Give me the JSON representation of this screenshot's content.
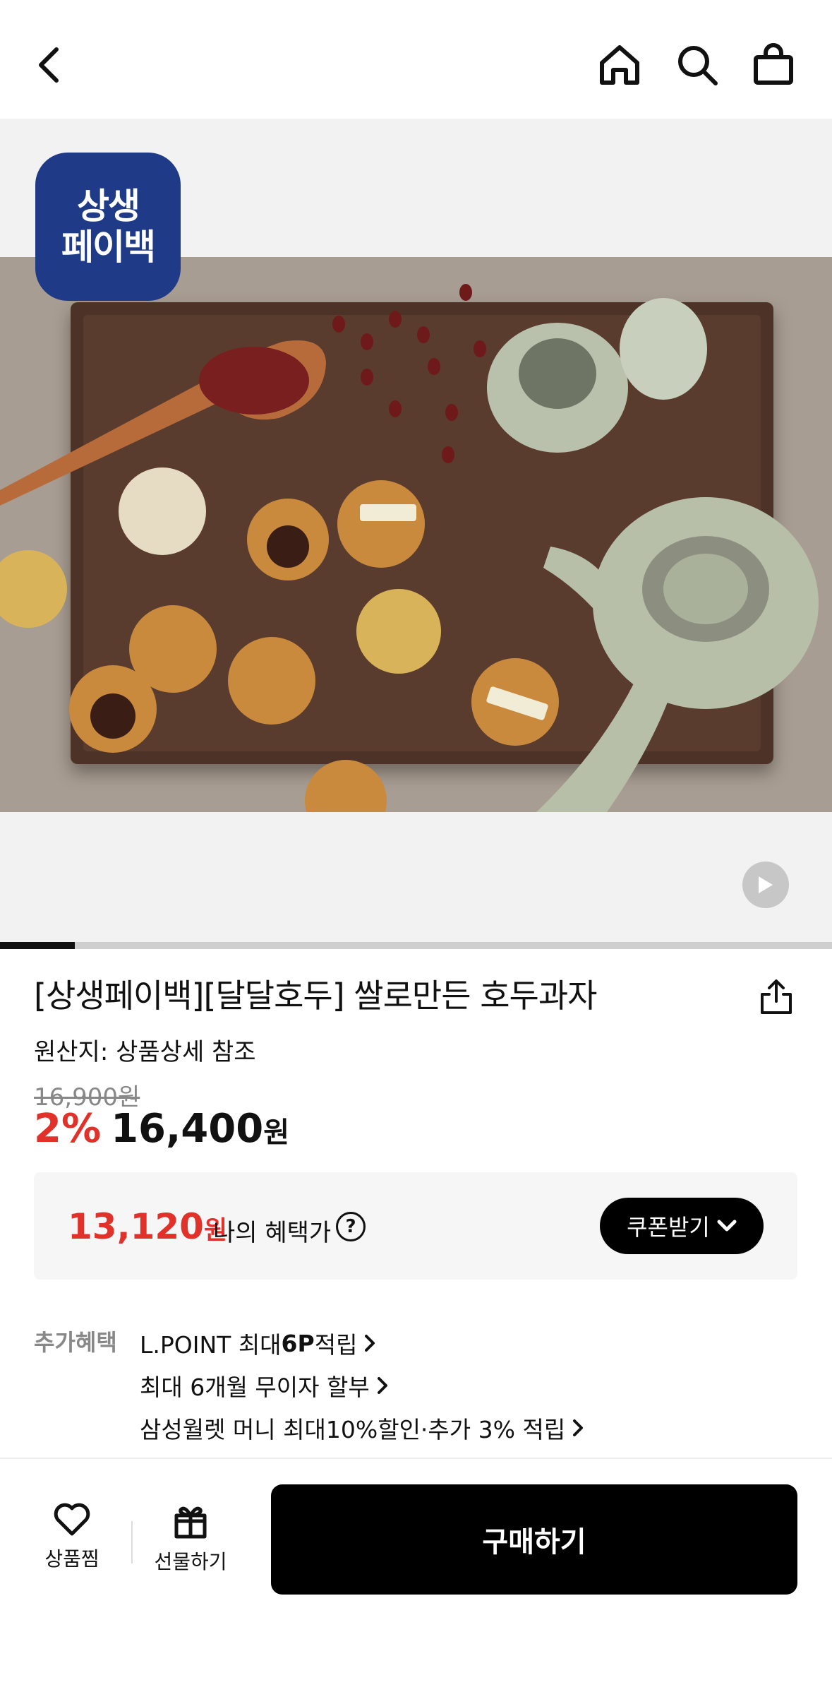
{
  "header": {
    "back_icon": "chevron-left-icon",
    "home_icon": "home-icon",
    "search_icon": "search-icon",
    "cart_icon": "shopping-bag-icon"
  },
  "gallery": {
    "badge_line1": "상생",
    "badge_line2": "페이백",
    "badge_color": "#1f3a86",
    "play_icon": "play-icon",
    "progress": 0.09
  },
  "product": {
    "title": "[상생페이백][달달호두] 쌀로만든 호두과자",
    "origin": "원산지: 상품상세 참조",
    "original_price": "16,900원",
    "discount_rate": "2%",
    "sale_price": "16,400",
    "currency": "원",
    "accent_color": "#e0322b"
  },
  "benefit": {
    "price": "13,120",
    "currency": "원",
    "label": "나의 혜택가",
    "help": "?",
    "coupon_label": "쿠폰받기"
  },
  "extra": {
    "label": "추가혜택",
    "items": [
      {
        "pre": "L.POINT 최대 ",
        "bold": "6P",
        "post": " 적립"
      },
      {
        "pre": "최대 6개월 무이자 할부",
        "bold": "",
        "post": ""
      },
      {
        "pre": "삼성월렛 머니 최대10%할인·추가 3% 적립",
        "bold": "",
        "post": ""
      }
    ]
  },
  "bottom": {
    "wish_label": "상품찜",
    "gift_label": "선물하기",
    "buy_label": "구매하기"
  }
}
